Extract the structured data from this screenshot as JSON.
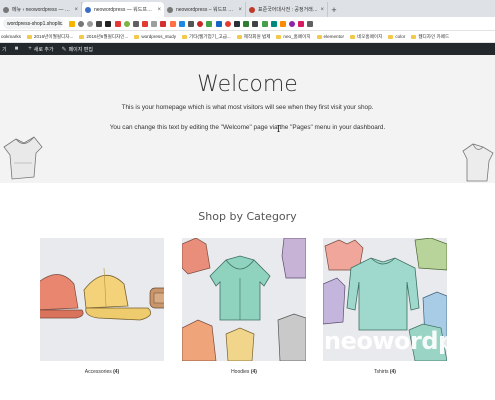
{
  "browser": {
    "tabs": [
      {
        "title": "메뉴 ‹ neowordpress — 워드프",
        "favicon_color": "#6a6a6a",
        "active": false
      },
      {
        "title": "neowordpress — 워드프레스 테",
        "favicon_color": "#3b6dc7",
        "active": true
      },
      {
        "title": "neowordpress – 워드프 워드프",
        "favicon_color": "#6a6a6a",
        "active": false
      },
      {
        "title": "표준국어대사전 : 공정거래위원회",
        "favicon_color": "#c0392b",
        "active": false
      }
    ],
    "new_tab_label": "+",
    "url": "wordpress-shop1.shoplic.ca...",
    "bookmarks_label": "ookmarks",
    "bookmarks": [
      "2016년이월될디자...",
      "2016년6월될디자인...",
      "wordpress_study",
      "기타(웹기업기_고급...",
      "제작회원 법제",
      "neo_홈페이지",
      "elementor",
      "네오홈페이지",
      "color",
      "웹디자인 카페드"
    ]
  },
  "adminbar": {
    "left_label": "기",
    "new_label": "새로 추가",
    "edit_label": "페이지 편집"
  },
  "hero": {
    "title": "Welcome",
    "line1": "This is your homepage which is what most visitors will see when they first visit your shop.",
    "line2": "You can change this text by editing the \"Welcome\" page via the \"Pages\" menu in your dashboard."
  },
  "shop": {
    "title": "Shop by Category",
    "categories": [
      {
        "name": "Accessories",
        "count": "(4)"
      },
      {
        "name": "Hoodies",
        "count": "(4)"
      },
      {
        "name": "Tshirts",
        "count": "(4)"
      }
    ]
  },
  "watermark": "neowordpress",
  "colors": {
    "admin_bar": "#23282d",
    "hero_bg": "#f3f3f3",
    "card_bg": "#e7e9ec"
  }
}
